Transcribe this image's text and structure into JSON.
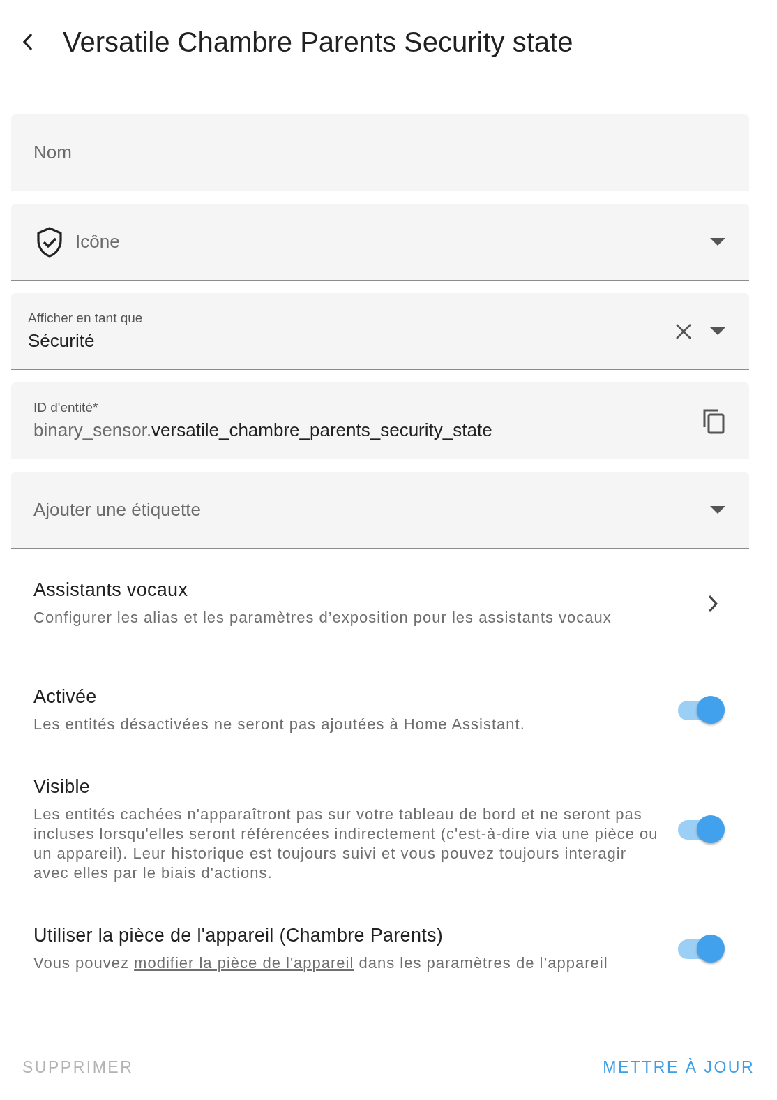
{
  "header": {
    "title": "Versatile Chambre Parents Security state"
  },
  "fields": [
    {
      "kind": "text",
      "placeholder": "Nom"
    },
    {
      "kind": "icon",
      "placeholder": "Icône"
    },
    {
      "kind": "select",
      "label": "Afficher en tant que",
      "value": "Sécurité"
    },
    {
      "kind": "entity",
      "label": "ID d'entité*",
      "prefix": "binary_sensor.",
      "value": "versatile_chambre_parents_security_state"
    },
    {
      "kind": "dropdown",
      "placeholder": "Ajouter une étiquette"
    }
  ],
  "voice": {
    "title": "Assistants vocaux",
    "description": "Configurer les alias et les paramètres d’exposition pour les assistants vocaux"
  },
  "settings": [
    {
      "title": "Activée",
      "description": "Les entités désactivées ne seront pas ajoutées à Home Assistant.",
      "on": true
    },
    {
      "title": "Visible",
      "description": "Les entités cachées n'apparaîtront pas sur votre tableau de bord et ne seront pas incluses lorsqu'elles seront référencées indirectement (c'est-à-dire via une pièce ou un appareil). Leur historique est toujours suivi et vous pouvez toujours interagir avec elles par le biais d'actions.",
      "on": true
    },
    {
      "title": "Utiliser la pièce de l'appareil (Chambre Parents)",
      "description": "Vous pouvez ",
      "link": "modifier la pièce de l'appareil",
      "description_after": " dans les paramètres de l’appareil",
      "on": true
    }
  ],
  "footer": {
    "delete": {
      "label": "SUPPRIMER",
      "disabled": true
    },
    "update": {
      "label": "METTRE À JOUR",
      "disabled": false
    }
  }
}
